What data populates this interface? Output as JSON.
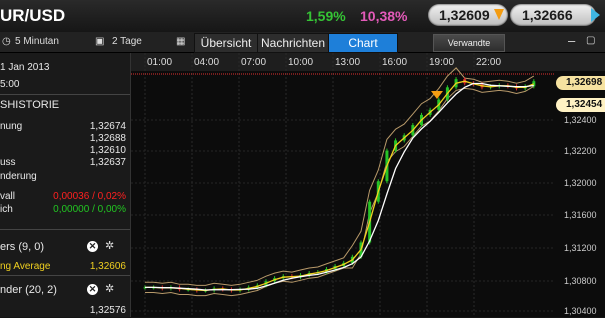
{
  "header": {
    "pair": "UR/USD",
    "change_pct": "1,59%",
    "change_pct_alt": "10,38%",
    "bid": "1,32609",
    "ask": "1,32666"
  },
  "toolbar": {
    "interval": "5 Minutan",
    "range": "2 Tage",
    "tabs": [
      "Übersicht",
      "Nachrichten",
      "Chart"
    ],
    "related": "Verwandte"
  },
  "sidebar": {
    "date": "1 Jan 2013",
    "time": "5:00",
    "section_title": "SHISTORIE",
    "rows": [
      {
        "label": "nung",
        "value": "1,32674"
      },
      {
        "label": "",
        "value": "1,32688"
      },
      {
        "label": "",
        "value": "1,32610"
      },
      {
        "label": "uss",
        "value": "1,32637"
      },
      {
        "label": "nderung",
        "value": ""
      },
      {
        "label": "vall",
        "value": "0,00036 / 0,02%"
      },
      {
        "label": "ich",
        "value": "0,00000 / 0,00%"
      }
    ],
    "indicator1": "ers (9, 0)",
    "indicator1_sub": "ng Average",
    "indicator1_value": "1,32606",
    "indicator2": "nder (20, 2)",
    "indicator2_value": "1,32576",
    "colors": {
      "negative": "#ff2020",
      "neutral": "#22c622",
      "highlight": "#f0d020"
    }
  },
  "chart_data": {
    "type": "line",
    "x_ticks": [
      "01:00",
      "04:00",
      "07:00",
      "10:00",
      "13:00",
      "16:00",
      "19:00",
      "22:00"
    ],
    "y_ticks": [
      "1,32400",
      "1,32200",
      "1,32000",
      "1,31600",
      "1,31200",
      "1,30800",
      "1,30400"
    ],
    "current_price_tags": [
      "1,32698",
      "1,32454"
    ],
    "x": [
      0,
      0.5,
      1,
      1.5,
      2,
      2.5,
      3,
      3.5,
      4,
      4.5,
      5,
      5.5,
      6,
      6.5,
      7,
      7.5,
      8,
      8.5,
      9,
      9.5,
      10,
      10.5,
      11,
      11.5,
      12,
      12.5,
      13,
      13.5,
      14,
      14.5,
      15,
      15.5,
      16,
      16.5,
      17,
      17.5,
      18,
      18.5,
      19,
      19.5,
      20,
      20.5,
      21,
      21.5,
      22,
      22.5
    ],
    "price": [
      1.3066,
      1.3066,
      1.3065,
      1.3066,
      1.3064,
      1.3064,
      1.3063,
      1.3063,
      1.3065,
      1.3064,
      1.3063,
      1.3064,
      1.3066,
      1.3068,
      1.3072,
      1.3075,
      1.3077,
      1.3076,
      1.3078,
      1.308,
      1.3081,
      1.3084,
      1.3087,
      1.309,
      1.3096,
      1.311,
      1.315,
      1.317,
      1.32,
      1.321,
      1.3215,
      1.3225,
      1.3235,
      1.324,
      1.325,
      1.3262,
      1.327,
      1.3266,
      1.3265,
      1.3262,
      1.3263,
      1.3264,
      1.3263,
      1.3261,
      1.3263,
      1.3268
    ],
    "ylim": [
      1.3037,
      1.3278
    ]
  }
}
